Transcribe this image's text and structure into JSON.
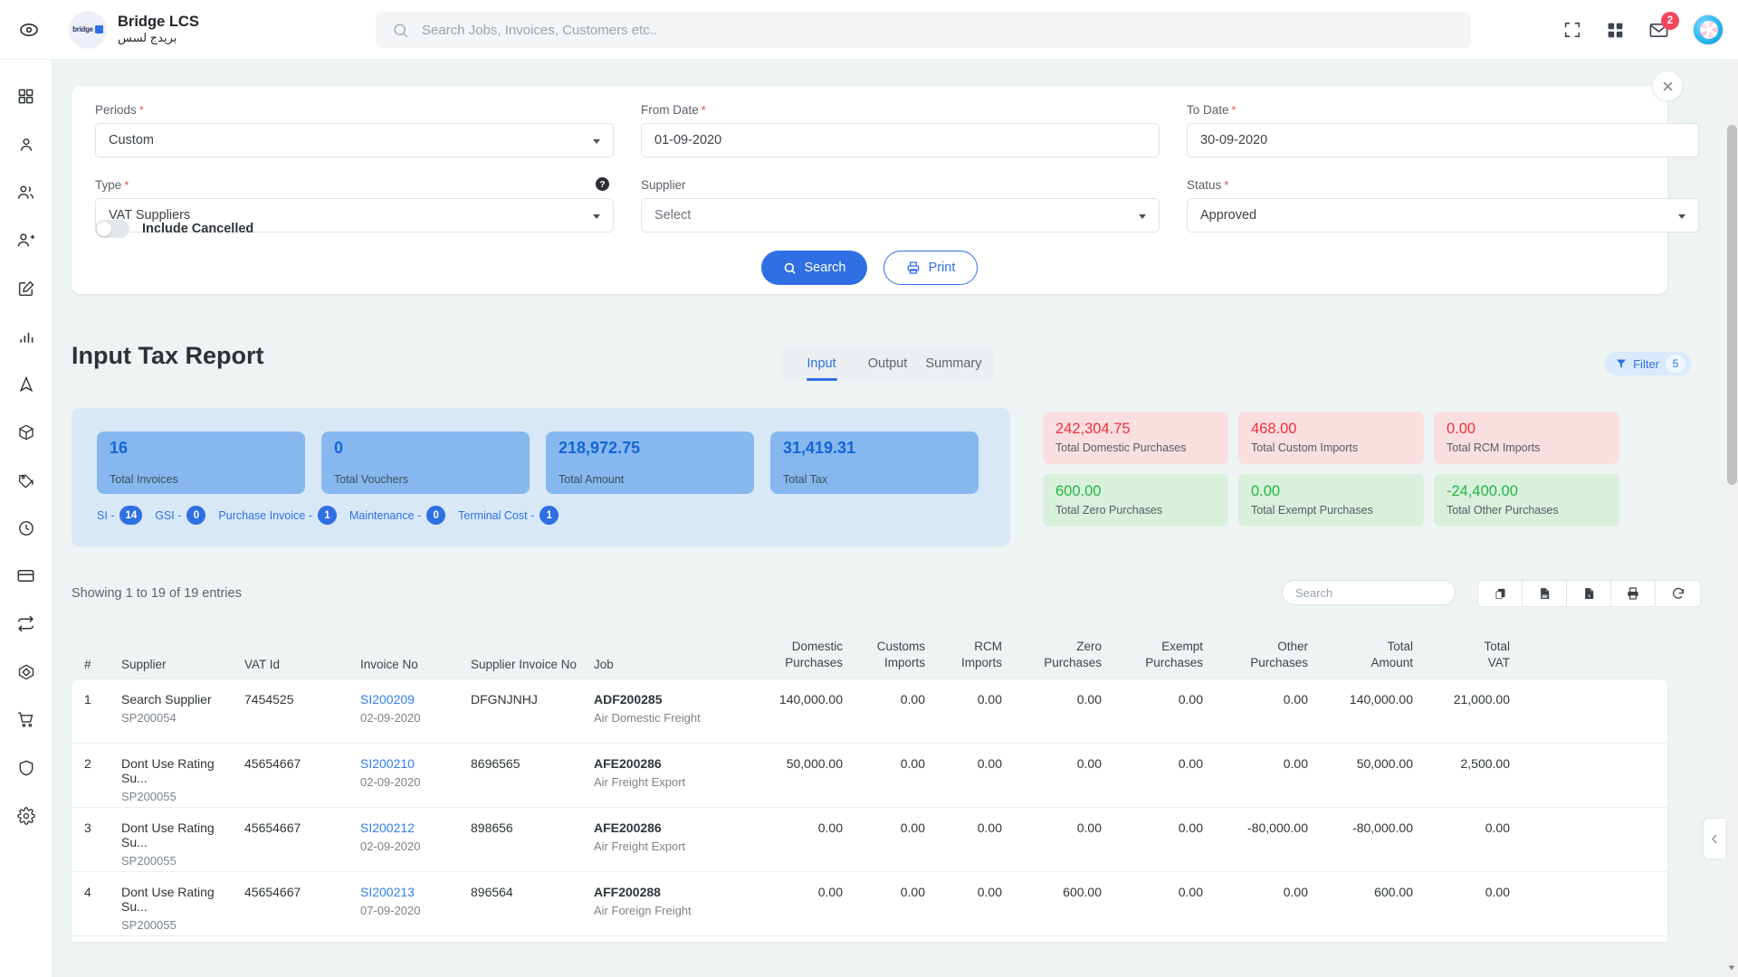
{
  "topbar": {
    "toggle_icon": "eye-toggle-icon",
    "brand_en": "Bridge LCS",
    "brand_ar": "بريدج لسس",
    "logo_text": "bridge",
    "search_placeholder": "Search Jobs, Invoices, Customers etc..",
    "search_value": "",
    "fullscreen_icon": "fullscreen-icon",
    "apps_icon": "apps-grid-icon",
    "mail_icon": "mail-icon",
    "mail_badge": "2",
    "avatar_icon": "user-avatar"
  },
  "sidebar": {
    "items": [
      {
        "name": "dashboard",
        "icon": "grid-icon"
      },
      {
        "name": "customer",
        "icon": "person-icon"
      },
      {
        "name": "users",
        "icon": "people-icon"
      },
      {
        "name": "add-user",
        "icon": "person-add-icon"
      },
      {
        "name": "quotation",
        "icon": "edit-square-icon"
      },
      {
        "name": "reports",
        "icon": "bar-chart-icon"
      },
      {
        "name": "jobs",
        "icon": "navigation-icon"
      },
      {
        "name": "shipment",
        "icon": "package-icon"
      },
      {
        "name": "pricing",
        "icon": "tag-icon"
      },
      {
        "name": "history",
        "icon": "clock-icon"
      },
      {
        "name": "payments",
        "icon": "credit-card-icon"
      },
      {
        "name": "transfers",
        "icon": "swap-icon"
      },
      {
        "name": "inventory",
        "icon": "cube-icon"
      },
      {
        "name": "purchase",
        "icon": "cart-icon"
      },
      {
        "name": "security",
        "icon": "shield-icon"
      },
      {
        "name": "settings",
        "icon": "gear-icon"
      }
    ]
  },
  "filter_panel": {
    "close_icon": "close-icon",
    "periods": {
      "label": "Periods",
      "required": "*",
      "value": "Custom"
    },
    "from_date": {
      "label": "From Date",
      "required": "*",
      "value": "01-09-2020"
    },
    "to_date": {
      "label": "To Date",
      "required": "*",
      "value": "30-09-2020"
    },
    "type": {
      "label": "Type",
      "required": "*",
      "value": "VAT Suppliers",
      "help_icon": "help-icon"
    },
    "supplier": {
      "label": "Supplier",
      "required": "",
      "value": "Select"
    },
    "status": {
      "label": "Status",
      "required": "*",
      "value": "Approved"
    },
    "include_cancelled": {
      "label": "Include Cancelled",
      "state": "off"
    },
    "search_button": {
      "label": "Search",
      "icon": "search-icon"
    },
    "print_button": {
      "label": "Print",
      "icon": "printer-icon"
    }
  },
  "report": {
    "title": "Input Tax Report",
    "tabs": [
      {
        "label": "Input",
        "active": true
      },
      {
        "label": "Output",
        "active": false
      },
      {
        "label": "Summary",
        "active": false
      }
    ],
    "filter_pill": {
      "label": "Filter",
      "count": "5",
      "icon": "funnel-icon"
    }
  },
  "stats": {
    "cards": [
      {
        "value": "16",
        "label": "Total Invoices"
      },
      {
        "value": "0",
        "label": "Total Vouchers"
      },
      {
        "value": "218,972.75",
        "label": "Total Amount"
      },
      {
        "value": "31,419.31",
        "label": "Total Tax"
      }
    ],
    "breakdown": [
      {
        "label": "SI -",
        "count": "14"
      },
      {
        "label": "GSI -",
        "count": "0"
      },
      {
        "label": "Purchase Invoice -",
        "count": "1"
      },
      {
        "label": "Maintenance -",
        "count": "0"
      },
      {
        "label": "Terminal Cost -",
        "count": "1"
      }
    ]
  },
  "summary_cards": [
    {
      "value": "242,304.75",
      "label": "Total Domestic Purchases",
      "tone": "red"
    },
    {
      "value": "468.00",
      "label": "Total Custom Imports",
      "tone": "red"
    },
    {
      "value": "0.00",
      "label": "Total RCM Imports",
      "tone": "red"
    },
    {
      "value": "600.00",
      "label": "Total Zero Purchases",
      "tone": "green"
    },
    {
      "value": "0.00",
      "label": "Total Exempt Purchases",
      "tone": "green"
    },
    {
      "value": "-24,400.00",
      "label": "Total Other Purchases",
      "tone": "green"
    }
  ],
  "table": {
    "showing": "Showing 1 to 19 of 19 entries",
    "search_placeholder": "Search",
    "search_value": "",
    "tools": [
      {
        "name": "copy-button",
        "icon": "copy-icon"
      },
      {
        "name": "csv-button",
        "icon": "csv-file-icon"
      },
      {
        "name": "excel-button",
        "icon": "excel-file-icon"
      },
      {
        "name": "print-button",
        "icon": "printer-icon"
      },
      {
        "name": "refresh-button",
        "icon": "refresh-icon"
      }
    ],
    "headers": {
      "idx": "#",
      "supplier": "Supplier",
      "vat_id": "VAT Id",
      "invoice_no": "Invoice No",
      "supplier_invoice_no": "Supplier Invoice No",
      "job": "Job",
      "domestic_purchases_1": "Domestic",
      "domestic_purchases_2": "Purchases",
      "customs_imports_1": "Customs",
      "customs_imports_2": "Imports",
      "rcm_imports_1": "RCM",
      "rcm_imports_2": "Imports",
      "zero_purchases_1": "Zero",
      "zero_purchases_2": "Purchases",
      "exempt_purchases_1": "Exempt",
      "exempt_purchases_2": "Purchases",
      "other_purchases_1": "Other",
      "other_purchases_2": "Purchases",
      "total_amount_1": "Total",
      "total_amount_2": "Amount",
      "total_vat_1": "Total",
      "total_vat_2": "VAT"
    },
    "rows": [
      {
        "idx": "1",
        "supplier": "Search Supplier",
        "supplier_code": "SP200054",
        "vat_id": "7454525",
        "invoice_no": "SI200209",
        "invoice_date": "02-09-2020",
        "supplier_invoice_no": "DFGNJNHJ",
        "job": "ADF200285",
        "job_desc": "Air Domestic Freight",
        "domestic": "140,000.00",
        "customs": "0.00",
        "rcm": "0.00",
        "zero": "0.00",
        "exempt": "0.00",
        "other": "0.00",
        "total_amount": "140,000.00",
        "total_vat": "21,000.00"
      },
      {
        "idx": "2",
        "supplier": "Dont Use Rating Su...",
        "supplier_code": "SP200055",
        "vat_id": "45654667",
        "invoice_no": "SI200210",
        "invoice_date": "02-09-2020",
        "supplier_invoice_no": "8696565",
        "job": "AFE200286",
        "job_desc": "Air Freight Export",
        "domestic": "50,000.00",
        "customs": "0.00",
        "rcm": "0.00",
        "zero": "0.00",
        "exempt": "0.00",
        "other": "0.00",
        "total_amount": "50,000.00",
        "total_vat": "2,500.00"
      },
      {
        "idx": "3",
        "supplier": "Dont Use Rating Su...",
        "supplier_code": "SP200055",
        "vat_id": "45654667",
        "invoice_no": "SI200212",
        "invoice_date": "02-09-2020",
        "supplier_invoice_no": "898656",
        "job": "AFE200286",
        "job_desc": "Air Freight Export",
        "domestic": "0.00",
        "customs": "0.00",
        "rcm": "0.00",
        "zero": "0.00",
        "exempt": "0.00",
        "other": "-80,000.00",
        "total_amount": "-80,000.00",
        "total_vat": "0.00"
      },
      {
        "idx": "4",
        "supplier": "Dont Use Rating Su...",
        "supplier_code": "SP200055",
        "vat_id": "45654667",
        "invoice_no": "SI200213",
        "invoice_date": "07-09-2020",
        "supplier_invoice_no": "896564",
        "job": "AFF200288",
        "job_desc": "Air Foreign Freight",
        "domestic": "0.00",
        "customs": "0.00",
        "rcm": "0.00",
        "zero": "600.00",
        "exempt": "0.00",
        "other": "0.00",
        "total_amount": "600.00",
        "total_vat": "0.00"
      }
    ]
  },
  "colors": {
    "accent": "#2f6fe4",
    "danger": "#f0303b",
    "success": "#22b840",
    "page_bg": "#eef3f3"
  }
}
